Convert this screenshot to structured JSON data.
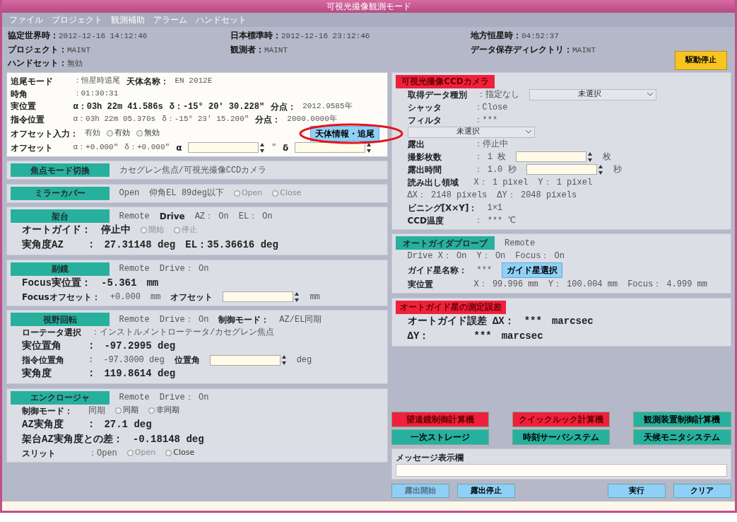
{
  "window": {
    "title": "可視光撮像観測モード"
  },
  "menu": [
    "ファイル",
    "プロジェクト",
    "観測補助",
    "アラーム",
    "ハンドセット"
  ],
  "header": [
    {
      "label": "協定世界時：",
      "value": "2012-12-16 14:12:46"
    },
    {
      "label": "日本標準時：",
      "value": "2012-12-16 23:12:46"
    },
    {
      "label": "地方恒星時：",
      "value": "04:52:37"
    },
    {
      "label": "プロジェクト：",
      "value": "MAINT"
    },
    {
      "label": "観測者：",
      "value": "MAINT"
    },
    {
      "label": "データ保存ディレクトリ：",
      "value": "MAINT"
    },
    {
      "label": "ハンドセット：",
      "value": "無効"
    }
  ],
  "stop_button": "駆動停止",
  "left_panels": [
    {
      "kind": "info",
      "lines": [
        [
          {
            "kind": "label",
            "text": "追尾モード"
          },
          {
            "kind": "value",
            "text": "：恒星時追尾"
          },
          {
            "kind": "label",
            "text": "天体名称："
          },
          {
            "kind": "value",
            "text": "EN 2012E"
          }
        ],
        [
          {
            "kind": "label",
            "text": "時角"
          },
          {
            "kind": "value",
            "text": "：01:30:31"
          }
        ],
        [
          {
            "kind": "big",
            "text": "実位置"
          },
          {
            "kind": "big",
            "text": "α：03h 22m 41.586s"
          },
          {
            "kind": "big",
            "text": "δ：-15° 20' 30.228\""
          },
          {
            "kind": "label",
            "text": "分点："
          },
          {
            "kind": "value",
            "text": "2012.9585年"
          }
        ],
        [
          {
            "kind": "label",
            "text": "指令位置"
          },
          {
            "kind": "value",
            "text": "α：03h 22m 05.370s"
          },
          {
            "kind": "value",
            "text": "δ：-15° 23' 15.200\""
          },
          {
            "kind": "label",
            "text": "分点："
          },
          {
            "kind": "value",
            "text": "2000.0000年"
          }
        ],
        [
          {
            "kind": "label",
            "text": "オフセット入力："
          },
          {
            "kind": "value",
            "text": "有効"
          },
          {
            "kind": "radio",
            "text": "有効",
            "selected": false,
            "disabled": false
          },
          {
            "kind": "radio",
            "text": "無効",
            "selected": false,
            "disabled": false
          },
          {
            "kind": "button",
            "text": "天体情報・追尾"
          }
        ],
        [
          {
            "kind": "label",
            "text": "オフセット"
          },
          {
            "kind": "value",
            "text": "α：+0.000\""
          },
          {
            "kind": "value",
            "text": "δ：+0.000\""
          },
          {
            "kind": "label",
            "text": "α"
          },
          {
            "kind": "spin"
          },
          {
            "kind": "value",
            "text": "\""
          },
          {
            "kind": "label",
            "text": "δ"
          },
          {
            "kind": "spin"
          }
        ]
      ]
    },
    {
      "kind": "section",
      "title": "焦点モード切換",
      "alert": false,
      "head": [
        {
          "kind": "value",
          "text": "カセグレン焦点/可視光撮像CCDカメラ"
        }
      ]
    },
    {
      "kind": "section",
      "title": "ミラーカバー",
      "alert": false,
      "head": [
        {
          "kind": "value",
          "text": "Open"
        },
        {
          "kind": "value",
          "text": "仰角EL 89deg以下"
        },
        {
          "kind": "radio",
          "text": "Open",
          "selected": false,
          "disabled": true
        },
        {
          "kind": "radio",
          "text": "Close",
          "selected": false,
          "disabled": true
        }
      ]
    },
    {
      "kind": "section",
      "title": "架台",
      "alert": false,
      "head": [
        {
          "kind": "value",
          "text": "Remote"
        },
        {
          "kind": "label",
          "text": "Drive"
        },
        {
          "kind": "value",
          "text": "AZ： On"
        },
        {
          "kind": "value",
          "text": "EL： On"
        }
      ],
      "lines": [
        [
          {
            "kind": "big",
            "text": "オートガイド："
          },
          {
            "kind": "big",
            "text": "停止中"
          },
          {
            "kind": "radio",
            "text": "開始",
            "selected": false,
            "disabled": true
          },
          {
            "kind": "radio",
            "text": "停止",
            "selected": false,
            "disabled": true
          }
        ],
        [
          {
            "kind": "big",
            "text": "実角度AZ"
          },
          {
            "kind": "big",
            "text": ":"
          },
          {
            "kind": "big",
            "text": "27.31148 deg"
          },
          {
            "kind": "big",
            "text": "EL：35.36616 deg"
          }
        ]
      ]
    },
    {
      "kind": "section",
      "title": "副鏡",
      "alert": false,
      "head": [
        {
          "kind": "value",
          "text": "Remote"
        },
        {
          "kind": "value",
          "text": "Drive： On"
        }
      ],
      "lines": [
        [
          {
            "kind": "big",
            "text": "Focus実位置："
          },
          {
            "kind": "big",
            "text": "-5.361"
          },
          {
            "kind": "big",
            "text": "mm"
          }
        ],
        [
          {
            "kind": "label",
            "text": "Focusオフセット："
          },
          {
            "kind": "value",
            "text": "+0.000"
          },
          {
            "kind": "value",
            "text": "mm"
          },
          {
            "kind": "label",
            "text": "オフセット"
          },
          {
            "kind": "spin"
          },
          {
            "kind": "value",
            "text": "mm"
          }
        ]
      ]
    },
    {
      "kind": "section",
      "title": "視野回転",
      "alert": false,
      "head": [
        {
          "kind": "value",
          "text": "Remote"
        },
        {
          "kind": "value",
          "text": "Drive： On"
        },
        {
          "kind": "label",
          "text": "制御モード："
        },
        {
          "kind": "value",
          "text": "AZ/EL同期"
        }
      ],
      "lines": [
        [
          {
            "kind": "label",
            "text": "ローテータ選択"
          },
          {
            "kind": "value",
            "text": "：インストルメントローテータ/カセグレン焦点"
          }
        ],
        [
          {
            "kind": "big",
            "text": "実位置角"
          },
          {
            "kind": "big",
            "text": ":"
          },
          {
            "kind": "big",
            "text": "-97.2995 deg"
          }
        ],
        [
          {
            "kind": "label",
            "text": "指令位置角"
          },
          {
            "kind": "value",
            "text": ":"
          },
          {
            "kind": "value",
            "text": "-97.3000 deg"
          },
          {
            "kind": "label",
            "text": "位置角"
          },
          {
            "kind": "spin"
          },
          {
            "kind": "value",
            "text": "deg"
          }
        ],
        [
          {
            "kind": "big",
            "text": "実角度"
          },
          {
            "kind": "big",
            "text": ":"
          },
          {
            "kind": "big",
            "text": "119.8614 deg"
          }
        ]
      ]
    },
    {
      "kind": "section",
      "title": "エンクロージャ",
      "alert": false,
      "head": [
        {
          "kind": "value",
          "text": "Remote"
        },
        {
          "kind": "value",
          "text": "Drive： On"
        }
      ],
      "lines": [
        [
          {
            "kind": "label",
            "text": "制御モード："
          },
          {
            "kind": "value",
            "text": "同期"
          },
          {
            "kind": "radio",
            "text": "同期",
            "selected": false,
            "disabled": false
          },
          {
            "kind": "radio",
            "text": "非同期",
            "selected": false,
            "disabled": false
          }
        ],
        [
          {
            "kind": "big",
            "text": "AZ実角度"
          },
          {
            "kind": "big",
            "text": ":"
          },
          {
            "kind": "big",
            "text": "27.1 deg"
          }
        ],
        [
          {
            "kind": "big",
            "text": "架台AZ実角度との差："
          },
          {
            "kind": "big",
            "text": "-0.18148 deg"
          }
        ],
        [
          {
            "kind": "label",
            "text": "スリット"
          },
          {
            "kind": "value",
            "text": "：Open"
          },
          {
            "kind": "radio",
            "text": "Open",
            "selected": false,
            "disabled": true
          },
          {
            "kind": "radio",
            "text": "Close",
            "selected": false,
            "disabled": false
          }
        ]
      ]
    }
  ],
  "right_panels": [
    {
      "kind": "section",
      "title": "可視光撮像CCDカメラ",
      "alert": true,
      "lines": [
        [
          {
            "kind": "label",
            "text": "取得データ種別"
          },
          {
            "kind": "value",
            "text": "：指定なし"
          },
          {
            "kind": "select",
            "text": "未選択"
          }
        ],
        [
          {
            "kind": "label",
            "text": "シャッタ"
          },
          {
            "kind": "value",
            "text": "：Close"
          }
        ],
        [
          {
            "kind": "label",
            "text": "フィルタ"
          },
          {
            "kind": "value",
            "text": "：***"
          }
        ],
        [
          {
            "kind": "select",
            "text": "未選択"
          }
        ],
        [
          {
            "kind": "label",
            "text": "露出"
          },
          {
            "kind": "value",
            "text": "：停止中"
          }
        ],
        [
          {
            "kind": "label",
            "text": "撮影枚数"
          },
          {
            "kind": "value",
            "text": "： 1 枚"
          },
          {
            "kind": "spin"
          },
          {
            "kind": "value",
            "text": "枚"
          }
        ],
        [
          {
            "kind": "label",
            "text": "露出時間"
          },
          {
            "kind": "value",
            "text": "： 1.0 秒"
          },
          {
            "kind": "spin"
          },
          {
            "kind": "value",
            "text": "秒"
          }
        ],
        [
          {
            "kind": "label",
            "text": "読み出し領域"
          },
          {
            "kind": "value",
            "text": "X： 1 pixel"
          },
          {
            "kind": "value",
            "text": "Y： 1 pixel"
          }
        ],
        [
          {
            "kind": "value",
            "text": "ΔX： 2148 pixels"
          },
          {
            "kind": "value",
            "text": "ΔY： 2048 pixels"
          }
        ],
        [
          {
            "kind": "label",
            "text": "ビニング[X×Y]："
          },
          {
            "kind": "value",
            "text": "1×1"
          }
        ],
        [
          {
            "kind": "label",
            "text": "CCD温度"
          },
          {
            "kind": "value",
            "text": "： ***  ℃"
          }
        ]
      ]
    },
    {
      "kind": "section",
      "title": "オートガイダプローブ",
      "alert": false,
      "head": [
        {
          "kind": "value",
          "text": "Remote"
        }
      ],
      "lines": [
        [
          {
            "kind": "value",
            "text": "Drive X： On"
          },
          {
            "kind": "value",
            "text": "Y： On"
          },
          {
            "kind": "value",
            "text": "Focus： On"
          }
        ],
        [
          {
            "kind": "label",
            "text": "ガイド星名称："
          },
          {
            "kind": "value",
            "text": "***"
          },
          {
            "kind": "button",
            "text": "ガイド星選択"
          }
        ],
        [
          {
            "kind": "label",
            "text": "実位置"
          },
          {
            "kind": "value",
            "text": "X： 99.996 mm"
          },
          {
            "kind": "value",
            "text": "Y： 100.004 mm"
          },
          {
            "kind": "value",
            "text": "Focus： 4.999 mm"
          }
        ]
      ]
    },
    {
      "kind": "section",
      "title": "オートガイド星の測定誤差",
      "alert": true,
      "lines": [
        [
          {
            "kind": "big",
            "text": "オートガイド誤差 ΔX："
          },
          {
            "kind": "big",
            "text": "***"
          },
          {
            "kind": "big",
            "text": "marcsec"
          }
        ],
        [
          {
            "kind": "big",
            "text": "ΔY："
          },
          {
            "kind": "big",
            "text": "***"
          },
          {
            "kind": "big",
            "text": "marcsec"
          }
        ]
      ]
    }
  ],
  "system_buttons": [
    {
      "label": "望遠鏡制御計算機",
      "alert": true
    },
    {
      "label": "クイックルック計算機",
      "alert": true
    },
    {
      "label": "観測装置制御計算機",
      "alert": false
    },
    {
      "label": "一次ストレージ",
      "alert": false
    },
    {
      "label": "時刻サーバシステム",
      "alert": false
    },
    {
      "label": "天候モニタシステム",
      "alert": false
    }
  ],
  "message": {
    "label": "メッセージ表示欄"
  },
  "bottom_buttons": [
    {
      "label": "露出開始",
      "disabled": true
    },
    {
      "label": "露出停止",
      "disabled": false
    },
    {
      "label": "実行",
      "disabled": false
    },
    {
      "label": "クリア",
      "disabled": false
    }
  ]
}
